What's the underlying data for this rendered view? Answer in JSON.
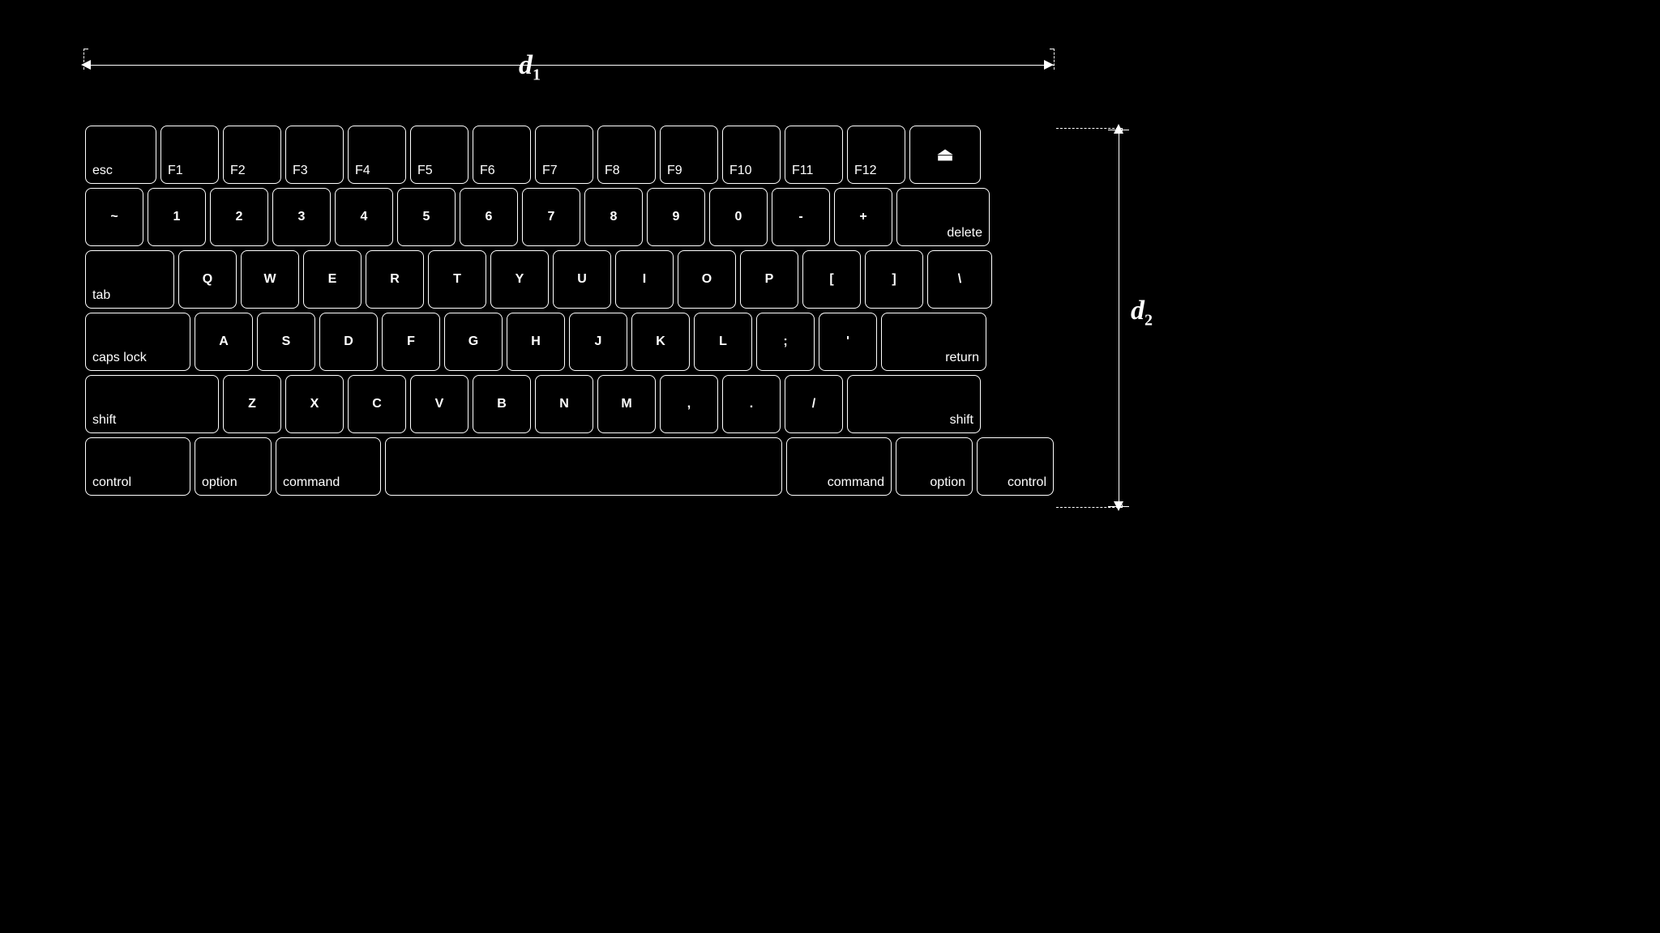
{
  "dimensions": {
    "d1_label": "d₁",
    "d2_label": "d₂"
  },
  "keyboard": {
    "rows": [
      {
        "id": "function-row",
        "keys": [
          {
            "id": "esc",
            "label": "esc",
            "class": "key-esc"
          },
          {
            "id": "f1",
            "label": "F1",
            "class": "key-fn"
          },
          {
            "id": "f2",
            "label": "F2",
            "class": "key-fn"
          },
          {
            "id": "f3",
            "label": "F3",
            "class": "key-fn"
          },
          {
            "id": "f4",
            "label": "F4",
            "class": "key-fn"
          },
          {
            "id": "f5",
            "label": "F5",
            "class": "key-fn"
          },
          {
            "id": "f6",
            "label": "F6",
            "class": "key-fn"
          },
          {
            "id": "f7",
            "label": "F7",
            "class": "key-fn"
          },
          {
            "id": "f8",
            "label": "F8",
            "class": "key-fn"
          },
          {
            "id": "f9",
            "label": "F9",
            "class": "key-fn"
          },
          {
            "id": "f10",
            "label": "F10",
            "class": "key-fn"
          },
          {
            "id": "f11",
            "label": "F11",
            "class": "key-fn"
          },
          {
            "id": "f12",
            "label": "F12",
            "class": "key-fn"
          },
          {
            "id": "eject",
            "label": "⏏",
            "class": "key-eject"
          }
        ]
      },
      {
        "id": "number-row",
        "keys": [
          {
            "id": "tilde",
            "label": "~",
            "class": "key-tilde center-label"
          },
          {
            "id": "1",
            "label": "1",
            "class": "key-num center-label"
          },
          {
            "id": "2",
            "label": "2",
            "class": "key-num center-label"
          },
          {
            "id": "3",
            "label": "3",
            "class": "key-num center-label"
          },
          {
            "id": "4",
            "label": "4",
            "class": "key-num center-label"
          },
          {
            "id": "5",
            "label": "5",
            "class": "key-num center-label"
          },
          {
            "id": "6",
            "label": "6",
            "class": "key-num center-label"
          },
          {
            "id": "7",
            "label": "7",
            "class": "key-num center-label"
          },
          {
            "id": "8",
            "label": "8",
            "class": "key-num center-label"
          },
          {
            "id": "9",
            "label": "9",
            "class": "key-num center-label"
          },
          {
            "id": "0",
            "label": "0",
            "class": "key-num center-label"
          },
          {
            "id": "minus",
            "label": "-",
            "class": "key-num center-label"
          },
          {
            "id": "plus",
            "label": "+",
            "class": "key-num center-label"
          },
          {
            "id": "delete",
            "label": "delete",
            "class": "key-delete"
          }
        ]
      },
      {
        "id": "qwerty-row",
        "keys": [
          {
            "id": "tab",
            "label": "tab",
            "class": "key-tab"
          },
          {
            "id": "q",
            "label": "Q",
            "class": "key-letter center-label"
          },
          {
            "id": "w",
            "label": "W",
            "class": "key-letter center-label"
          },
          {
            "id": "e",
            "label": "E",
            "class": "key-letter center-label"
          },
          {
            "id": "r",
            "label": "R",
            "class": "key-letter center-label"
          },
          {
            "id": "t",
            "label": "T",
            "class": "key-letter center-label"
          },
          {
            "id": "y",
            "label": "Y",
            "class": "key-letter center-label"
          },
          {
            "id": "u",
            "label": "U",
            "class": "key-letter center-label"
          },
          {
            "id": "i",
            "label": "I",
            "class": "key-letter center-label"
          },
          {
            "id": "o",
            "label": "O",
            "class": "key-letter center-label"
          },
          {
            "id": "p",
            "label": "P",
            "class": "key-letter center-label"
          },
          {
            "id": "bracket-open",
            "label": "[",
            "class": "key-letter center-label"
          },
          {
            "id": "bracket-close",
            "label": "]",
            "class": "key-letter center-label"
          },
          {
            "id": "backslash",
            "label": "\\",
            "class": "key-backslash center-label"
          }
        ]
      },
      {
        "id": "asdf-row",
        "keys": [
          {
            "id": "caps-lock",
            "label": "caps lock",
            "class": "key-caps"
          },
          {
            "id": "a",
            "label": "A",
            "class": "key-letter center-label"
          },
          {
            "id": "s",
            "label": "S",
            "class": "key-letter center-label"
          },
          {
            "id": "d",
            "label": "D",
            "class": "key-letter center-label"
          },
          {
            "id": "f",
            "label": "F",
            "class": "key-letter center-label"
          },
          {
            "id": "g",
            "label": "G",
            "class": "key-letter center-label"
          },
          {
            "id": "h",
            "label": "H",
            "class": "key-letter center-label"
          },
          {
            "id": "j",
            "label": "J",
            "class": "key-letter center-label"
          },
          {
            "id": "k",
            "label": "K",
            "class": "key-letter center-label"
          },
          {
            "id": "l",
            "label": "L",
            "class": "key-letter center-label"
          },
          {
            "id": "semicolon",
            "label": ";",
            "class": "key-letter center-label"
          },
          {
            "id": "quote",
            "label": "'",
            "class": "key-letter center-label"
          },
          {
            "id": "return",
            "label": "return",
            "class": "key-return"
          }
        ]
      },
      {
        "id": "zxcv-row",
        "keys": [
          {
            "id": "shift-left",
            "label": "shift",
            "class": "key-shift-l"
          },
          {
            "id": "z",
            "label": "Z",
            "class": "key-letter center-label"
          },
          {
            "id": "x",
            "label": "X",
            "class": "key-letter center-label"
          },
          {
            "id": "c",
            "label": "C",
            "class": "key-letter center-label"
          },
          {
            "id": "v",
            "label": "V",
            "class": "key-letter center-label"
          },
          {
            "id": "b",
            "label": "B",
            "class": "key-letter center-label"
          },
          {
            "id": "n",
            "label": "N",
            "class": "key-letter center-label"
          },
          {
            "id": "m",
            "label": "M",
            "class": "key-letter center-label"
          },
          {
            "id": "comma",
            "label": ",",
            "class": "key-letter center-label"
          },
          {
            "id": "period",
            "label": ".",
            "class": "key-letter center-label"
          },
          {
            "id": "slash",
            "label": "/",
            "class": "key-letter center-label"
          },
          {
            "id": "shift-right",
            "label": "shift",
            "class": "key-shift-r"
          }
        ]
      },
      {
        "id": "bottom-row",
        "keys": [
          {
            "id": "control-left",
            "label": "control",
            "class": "key-control"
          },
          {
            "id": "option-left",
            "label": "option",
            "class": "key-option"
          },
          {
            "id": "command-left",
            "label": "command",
            "class": "key-command"
          },
          {
            "id": "space",
            "label": "",
            "class": "key-space"
          },
          {
            "id": "command-right",
            "label": "command",
            "class": "key-command-r"
          },
          {
            "id": "option-right",
            "label": "option",
            "class": "key-option-r"
          },
          {
            "id": "control-right",
            "label": "control",
            "class": "key-control-r"
          }
        ]
      }
    ]
  }
}
